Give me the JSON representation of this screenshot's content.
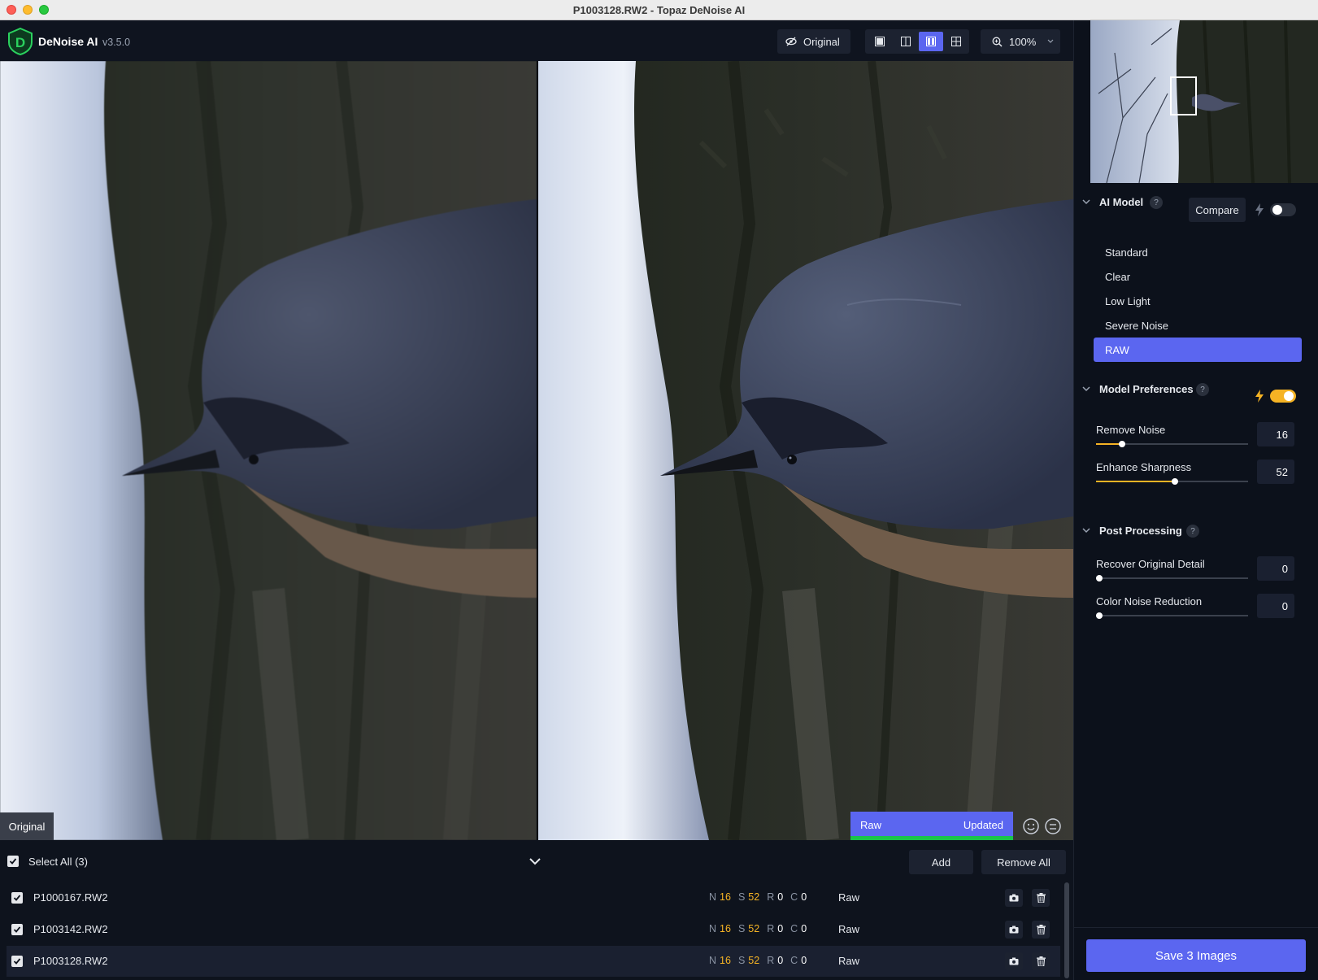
{
  "window": {
    "title": "P1003128.RW2 - Topaz DeNoise AI"
  },
  "toolbar": {
    "app_name": "DeNoise AI",
    "version": "v3.5.0",
    "original_label": "Original",
    "zoom": "100%"
  },
  "preview": {
    "original_label": "Original",
    "status_left": "Raw",
    "status_right": "Updated"
  },
  "filelist": {
    "select_all": "Select All (3)",
    "add_label": "Add",
    "remove_all_label": "Remove All",
    "files": [
      {
        "name": "P1000167.RW2",
        "n": "16",
        "s": "52",
        "r": "0",
        "c": "0",
        "model": "Raw"
      },
      {
        "name": "P1003142.RW2",
        "n": "16",
        "s": "52",
        "r": "0",
        "c": "0",
        "model": "Raw"
      },
      {
        "name": "P1003128.RW2",
        "n": "16",
        "s": "52",
        "r": "0",
        "c": "0",
        "model": "Raw"
      }
    ],
    "param_keys": {
      "n": "N",
      "s": "S",
      "r": "R",
      "c": "C"
    }
  },
  "ai_model": {
    "title": "AI Model",
    "help": "?",
    "compare_label": "Compare",
    "models": [
      "Standard",
      "Clear",
      "Low Light",
      "Severe Noise",
      "RAW"
    ],
    "selected": "RAW"
  },
  "model_preferences": {
    "title": "Model Preferences",
    "help": "?",
    "remove_noise": {
      "label": "Remove Noise",
      "value": "16"
    },
    "enhance_sharpness": {
      "label": "Enhance Sharpness",
      "value": "52"
    }
  },
  "post_processing": {
    "title": "Post Processing",
    "help": "?",
    "recover_detail": {
      "label": "Recover Original Detail",
      "value": "0"
    },
    "color_noise": {
      "label": "Color Noise Reduction",
      "value": "0"
    }
  },
  "save": {
    "label": "Save 3 Images"
  },
  "colors": {
    "accent": "#5b66f0",
    "highlight": "#f5b324",
    "progress": "#19c54a"
  }
}
